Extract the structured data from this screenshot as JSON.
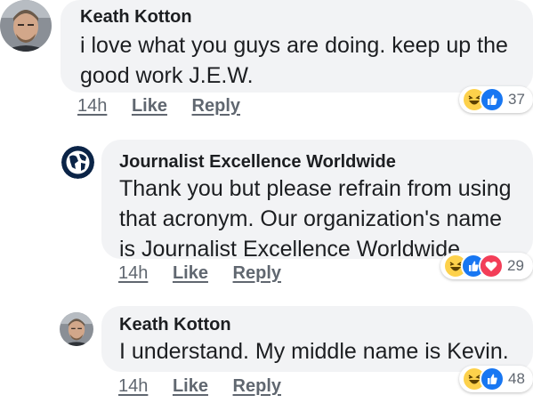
{
  "comments": [
    {
      "author": "Keath Kotton",
      "text": "i love what you guys are doing.  keep up the\ngood work J.E.W.",
      "time": "14h",
      "like": "Like",
      "reply": "Reply",
      "reactions": [
        "haha",
        "like"
      ],
      "reaction_count": "37"
    },
    {
      "author": "Journalist Excellence Worldwide",
      "text": "Thank you but please refrain from using\nthat acronym. Our organization's name\nis Journalist Excellence Worldwide.",
      "time": "14h",
      "like": "Like",
      "reply": "Reply",
      "reactions": [
        "haha",
        "like",
        "love"
      ],
      "reaction_count": "29"
    },
    {
      "author": "Keath Kotton",
      "text": "I understand.  My middle name is Kevin.",
      "time": "14h",
      "like": "Like",
      "reply": "Reply",
      "reactions": [
        "haha",
        "like"
      ],
      "reaction_count": "48"
    }
  ],
  "colors": {
    "bubble": "#f2f3f5",
    "like_blue": "#1877f2",
    "love_red": "#f33e58",
    "haha_yellow": "#fdd14b",
    "meta_grey": "#606770"
  },
  "icons": {
    "user_avatar": "user-photo-avatar",
    "page_avatar": "globe-logo-avatar"
  }
}
